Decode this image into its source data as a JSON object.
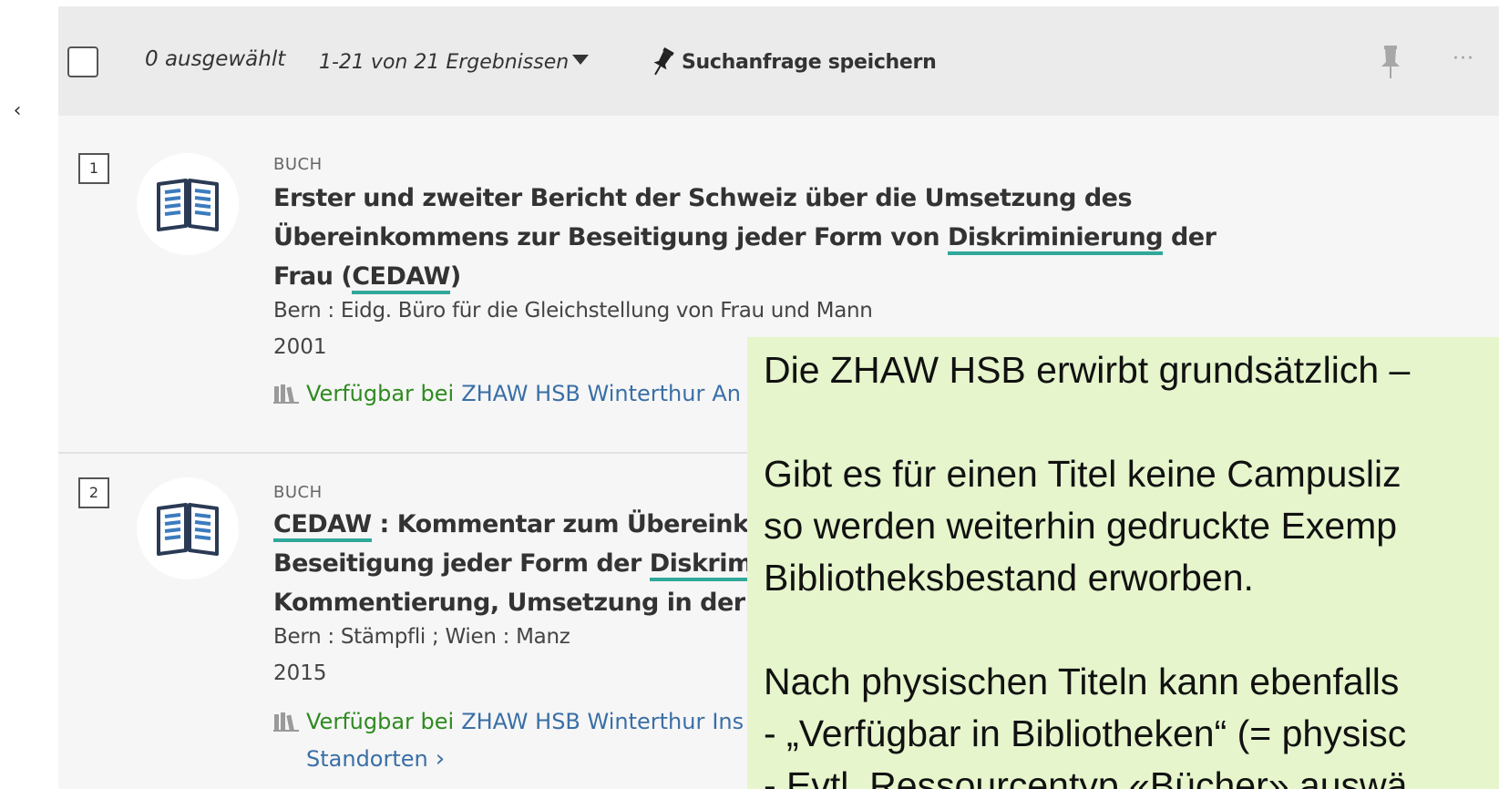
{
  "toolbar": {
    "selected_count": "0 ausgewählt",
    "results_range": "1-21 von 21 Ergebnissen",
    "save_query_label": "Suchanfrage speichern",
    "more_label": "···"
  },
  "results": [
    {
      "number": "1",
      "type": "BUCH",
      "title_lines": [
        "Erster und zweiter Bericht der Schweiz über die Umsetzung des",
        "Übereinkommens zur Beseitigung jeder Form von ",
        "Diskriminierung",
        " der",
        "Frau (",
        "CEDAW",
        ")"
      ],
      "publisher": "Bern : Eidg. Büro für die Gleichstellung von Frau und Mann",
      "year": "2001",
      "availability_status": "Verfügbar bei",
      "availability_location": "ZHAW HSB Winterthur",
      "availability_more": "An"
    },
    {
      "number": "2",
      "type": "BUCH",
      "title_lines": [
        "CEDAW",
        " : Kommentar zum Übereinko",
        "Beseitigung jeder Form der ",
        "Diskrimin",
        "Kommentierung, Umsetzung in der S"
      ],
      "publisher": "Bern : Stämpfli ; Wien : Manz",
      "year": "2015",
      "availability_status": "Verfügbar bei",
      "availability_location": "ZHAW HSB Winterthur",
      "availability_more": "Ins",
      "more_locations": "Standorten"
    }
  ],
  "note": {
    "line1": "Die ZHAW HSB erwirbt grundsätzlich –",
    "line2": "Gibt es für einen Titel keine Campusliz",
    "line3": "so werden weiterhin gedruckte Exemp",
    "line4": "Bibliotheksbestand erworben.",
    "line5": "Nach physischen Titeln kann ebenfalls",
    "line6": "- „Verfügbar in Bibliotheken“ (= physisc",
    "line7": "- Evtl. Ressourcentyp «Bücher» auswä"
  },
  "colors": {
    "accent_underline": "#2fa89a",
    "available_green": "#2e8b1e",
    "link_blue": "#3a6fa6",
    "note_background": "#e6f5cc"
  },
  "icons": [
    "back-arrow-icon",
    "pin-icon",
    "book-icon",
    "library-icon",
    "chevron-right-icon"
  ]
}
